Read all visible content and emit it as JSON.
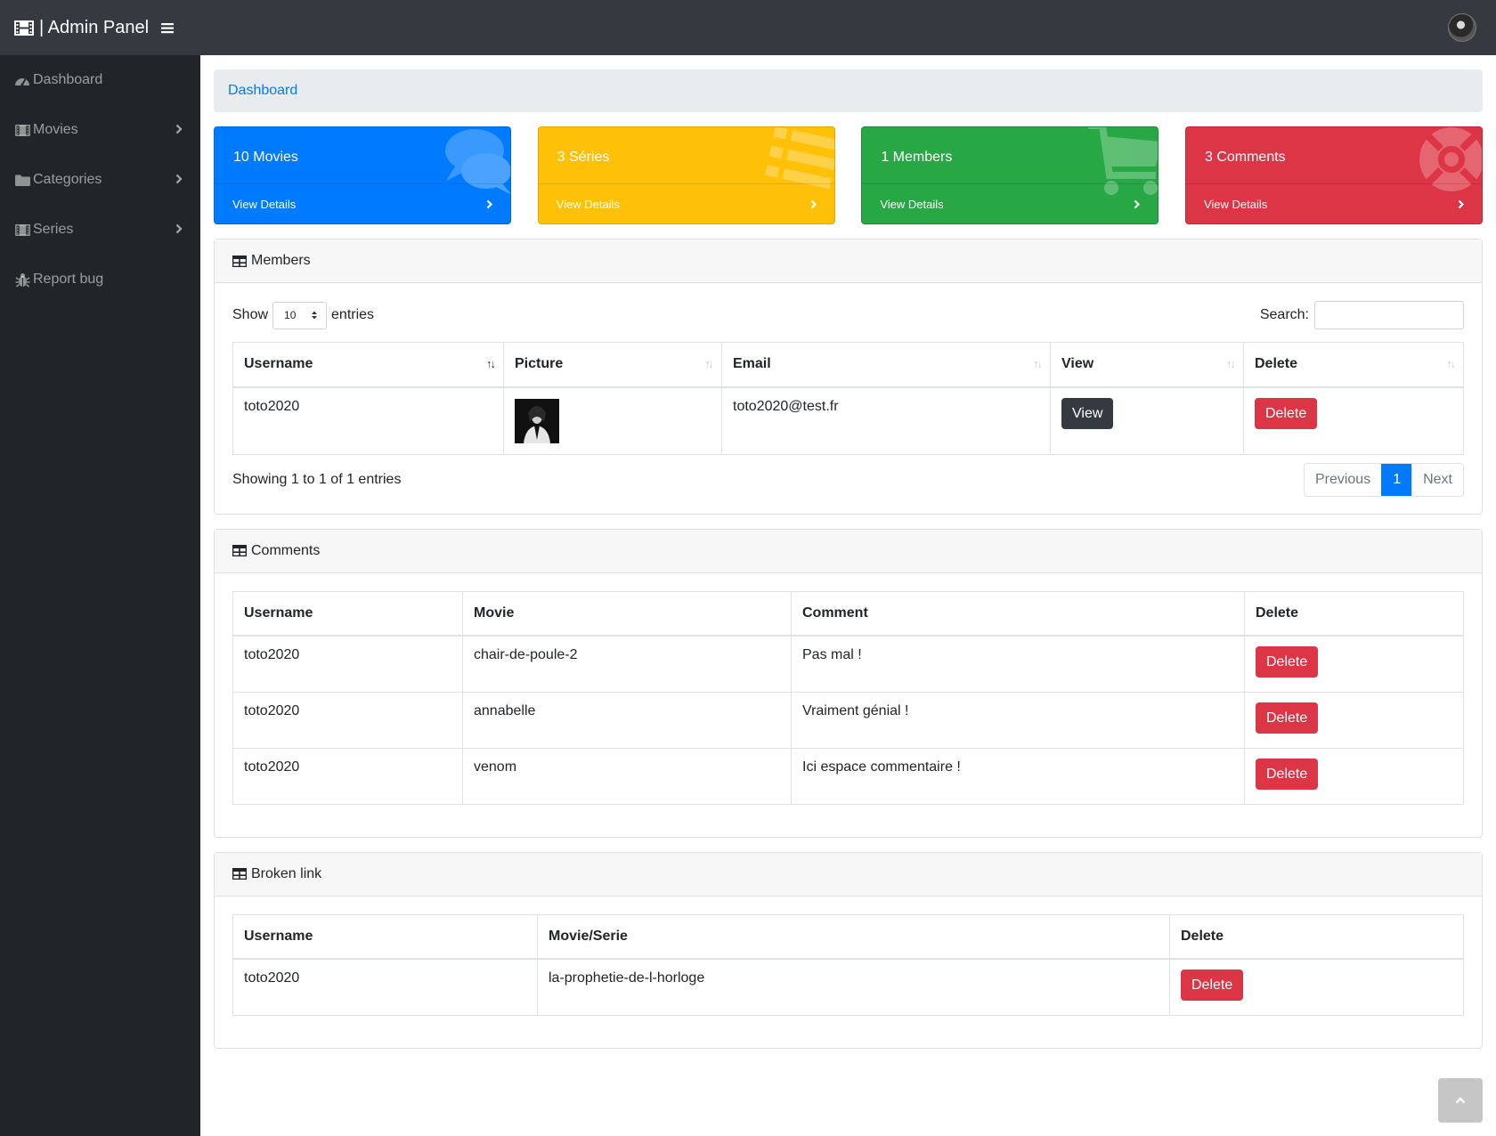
{
  "navbar": {
    "brand": "| Admin Panel"
  },
  "sidebar": {
    "items": [
      {
        "label": "Dashboard",
        "icon": "tachometer-icon"
      },
      {
        "label": "Movies",
        "icon": "film-icon"
      },
      {
        "label": "Categories",
        "icon": "folder-icon"
      },
      {
        "label": "Series",
        "icon": "film-icon"
      },
      {
        "label": "Report bug",
        "icon": "bug-icon"
      }
    ]
  },
  "breadcrumb": {
    "label": "Dashboard"
  },
  "cards": [
    {
      "title": "10 Movies",
      "footer": "View Details",
      "color": "#007bff",
      "icon": "comments-icon"
    },
    {
      "title": "3 Séries",
      "footer": "View Details",
      "color": "#ffc107",
      "icon": "list-icon"
    },
    {
      "title": "1 Members",
      "footer": "View Details",
      "color": "#28a745",
      "icon": "shopping-cart-icon"
    },
    {
      "title": "3 Comments",
      "footer": "View Details",
      "color": "#dc3545",
      "icon": "life-ring-icon"
    }
  ],
  "members": {
    "title": "Members",
    "show_label": "Show",
    "entries_label": "entries",
    "page_length": "10",
    "search_label": "Search:",
    "search_value": "",
    "columns": [
      "Username",
      "Picture",
      "Email",
      "View",
      "Delete"
    ],
    "rows": [
      {
        "username": "toto2020",
        "email": "toto2020@test.fr",
        "view_label": "View",
        "delete_label": "Delete"
      }
    ],
    "info": "Showing 1 to 1 of 1 entries",
    "pagination": {
      "previous": "Previous",
      "current": "1",
      "next": "Next"
    }
  },
  "comments": {
    "title": "Comments",
    "columns": [
      "Username",
      "Movie",
      "Comment",
      "Delete"
    ],
    "rows": [
      {
        "username": "toto2020",
        "movie": "chair-de-poule-2",
        "comment": "Pas mal !",
        "delete_label": "Delete"
      },
      {
        "username": "toto2020",
        "movie": "annabelle",
        "comment": "Vraiment génial !",
        "delete_label": "Delete"
      },
      {
        "username": "toto2020",
        "movie": "venom",
        "comment": "Ici espace commentaire !",
        "delete_label": "Delete"
      }
    ]
  },
  "broken_links": {
    "title": "Broken link",
    "columns": [
      "Username",
      "Movie/Serie",
      "Delete"
    ],
    "rows": [
      {
        "username": "toto2020",
        "movie_serie": "la-prophetie-de-l-horloge",
        "delete_label": "Delete"
      }
    ]
  },
  "colors": {
    "navbar": "#343a40",
    "sidebar": "#212529",
    "primary": "#007bff",
    "danger": "#dc3545",
    "warning": "#ffc107",
    "success": "#28a745"
  }
}
